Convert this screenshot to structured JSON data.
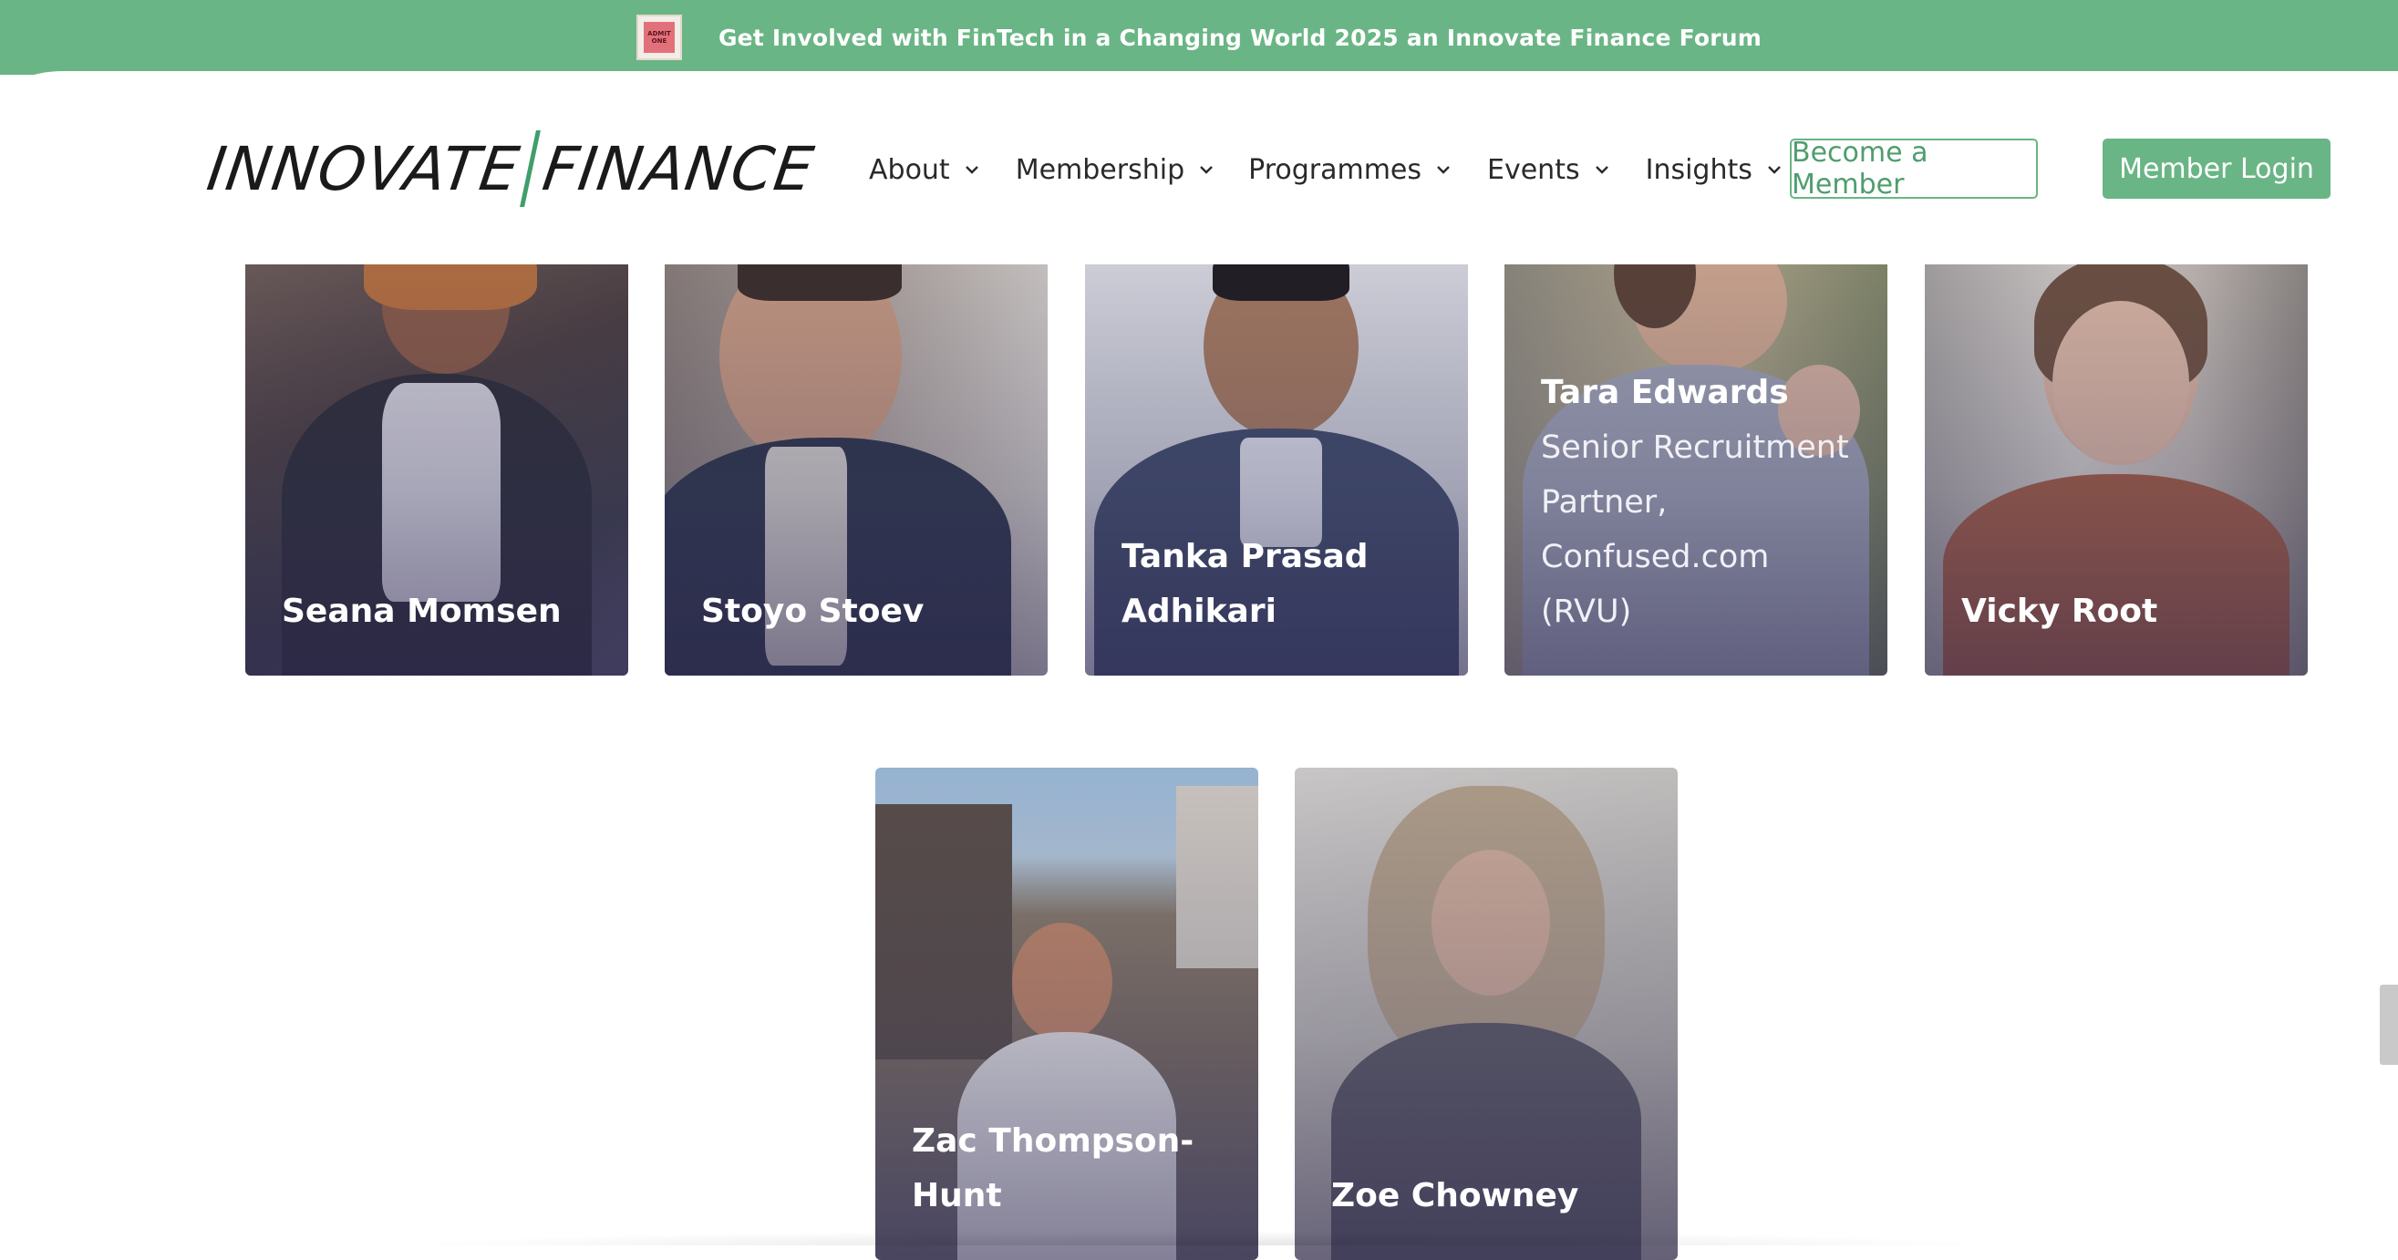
{
  "banner": {
    "thumb_text": "ADMIT ONE",
    "text": "Get Involved with FinTech in a Changing World 2025 an Innovate Finance Forum"
  },
  "logo": {
    "left": "INNOVATE",
    "right": "FINANCE"
  },
  "nav": {
    "items": [
      {
        "label": "About"
      },
      {
        "label": "Membership"
      },
      {
        "label": "Programmes"
      },
      {
        "label": "Events"
      },
      {
        "label": "Insights"
      }
    ],
    "become_member": "Become a Member",
    "member_login": "Member Login"
  },
  "people": [
    {
      "name": "Seana Momsen",
      "role": ""
    },
    {
      "name": "Stoyo Stoev",
      "role": ""
    },
    {
      "name": "Tanka Prasad Adhikari",
      "role": ""
    },
    {
      "name": "Tara Edwards",
      "role": "Senior Recruitment Partner, Confused.com (RVU)"
    },
    {
      "name": "Vicky Root",
      "role": ""
    },
    {
      "name": "Zac Thompson-Hunt",
      "role": ""
    },
    {
      "name": "Zoe Chowney",
      "role": ""
    }
  ],
  "colors": {
    "brand_green": "#6ab585",
    "card_tint": "#3c3c6e",
    "text_dark": "#2a2a2a"
  }
}
